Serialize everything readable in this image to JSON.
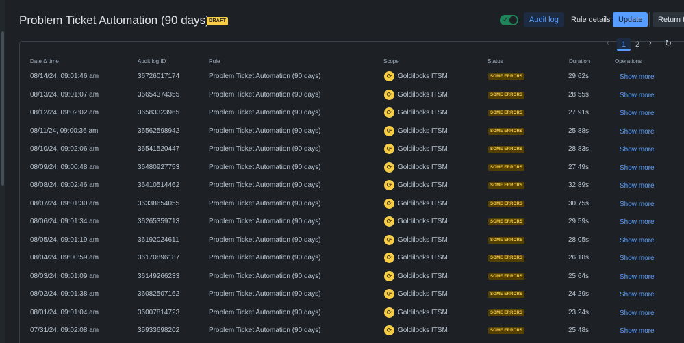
{
  "header": {
    "title": "Problem Ticket Automation (90 days)",
    "badge": "DRAFT",
    "toggle_check": "✓",
    "buttons": {
      "audit_log": "Audit log",
      "rule_details": "Rule details",
      "update": "Update",
      "return": "Return to list"
    }
  },
  "pagination": {
    "prev": "‹",
    "next": "›",
    "pages": [
      "1",
      "2"
    ],
    "current": "1",
    "refresh": "↻"
  },
  "table": {
    "columns": {
      "date": "Date & time",
      "audit_id": "Audit log ID",
      "rule": "Rule",
      "scope": "Scope",
      "status": "Status",
      "duration": "Duration",
      "operations": "Operations"
    },
    "rows": [
      {
        "date": "08/14/24, 09:01:46 am",
        "id": "36726017174",
        "rule": "Problem Ticket Automation (90 days)",
        "scope": "Goldilocks ITSM",
        "status": "SOME ERRORS",
        "duration": "29.62s",
        "op": "Show more"
      },
      {
        "date": "08/13/24, 09:01:07 am",
        "id": "36654374355",
        "rule": "Problem Ticket Automation (90 days)",
        "scope": "Goldilocks ITSM",
        "status": "SOME ERRORS",
        "duration": "28.55s",
        "op": "Show more"
      },
      {
        "date": "08/12/24, 09:02:02 am",
        "id": "36583323965",
        "rule": "Problem Ticket Automation (90 days)",
        "scope": "Goldilocks ITSM",
        "status": "SOME ERRORS",
        "duration": "27.91s",
        "op": "Show more"
      },
      {
        "date": "08/11/24, 09:00:36 am",
        "id": "36562598942",
        "rule": "Problem Ticket Automation (90 days)",
        "scope": "Goldilocks ITSM",
        "status": "SOME ERRORS",
        "duration": "25.88s",
        "op": "Show more"
      },
      {
        "date": "08/10/24, 09:02:06 am",
        "id": "36541520447",
        "rule": "Problem Ticket Automation (90 days)",
        "scope": "Goldilocks ITSM",
        "status": "SOME ERRORS",
        "duration": "28.83s",
        "op": "Show more"
      },
      {
        "date": "08/09/24, 09:00:48 am",
        "id": "36480927753",
        "rule": "Problem Ticket Automation (90 days)",
        "scope": "Goldilocks ITSM",
        "status": "SOME ERRORS",
        "duration": "27.49s",
        "op": "Show more"
      },
      {
        "date": "08/08/24, 09:02:46 am",
        "id": "36410514462",
        "rule": "Problem Ticket Automation (90 days)",
        "scope": "Goldilocks ITSM",
        "status": "SOME ERRORS",
        "duration": "32.89s",
        "op": "Show more"
      },
      {
        "date": "08/07/24, 09:01:30 am",
        "id": "36338654055",
        "rule": "Problem Ticket Automation (90 days)",
        "scope": "Goldilocks ITSM",
        "status": "SOME ERRORS",
        "duration": "30.75s",
        "op": "Show more"
      },
      {
        "date": "08/06/24, 09:01:34 am",
        "id": "36265359713",
        "rule": "Problem Ticket Automation (90 days)",
        "scope": "Goldilocks ITSM",
        "status": "SOME ERRORS",
        "duration": "29.59s",
        "op": "Show more"
      },
      {
        "date": "08/05/24, 09:01:19 am",
        "id": "36192024611",
        "rule": "Problem Ticket Automation (90 days)",
        "scope": "Goldilocks ITSM",
        "status": "SOME ERRORS",
        "duration": "28.05s",
        "op": "Show more"
      },
      {
        "date": "08/04/24, 09:00:59 am",
        "id": "36170896187",
        "rule": "Problem Ticket Automation (90 days)",
        "scope": "Goldilocks ITSM",
        "status": "SOME ERRORS",
        "duration": "26.18s",
        "op": "Show more"
      },
      {
        "date": "08/03/24, 09:01:09 am",
        "id": "36149266233",
        "rule": "Problem Ticket Automation (90 days)",
        "scope": "Goldilocks ITSM",
        "status": "SOME ERRORS",
        "duration": "25.64s",
        "op": "Show more"
      },
      {
        "date": "08/02/24, 09:01:38 am",
        "id": "36082507162",
        "rule": "Problem Ticket Automation (90 days)",
        "scope": "Goldilocks ITSM",
        "status": "SOME ERRORS",
        "duration": "24.29s",
        "op": "Show more"
      },
      {
        "date": "08/01/24, 09:01:04 am",
        "id": "36007814723",
        "rule": "Problem Ticket Automation (90 days)",
        "scope": "Goldilocks ITSM",
        "status": "SOME ERRORS",
        "duration": "23.24s",
        "op": "Show more"
      },
      {
        "date": "07/31/24, 09:02:08 am",
        "id": "35933698202",
        "rule": "Problem Ticket Automation (90 days)",
        "scope": "Goldilocks ITSM",
        "status": "SOME ERRORS",
        "duration": "25.48s",
        "op": "Show more"
      }
    ]
  },
  "colors": {
    "background": "#1d2125",
    "accent": "#579dff",
    "warning_text": "#f5cd47",
    "warning_bg": "#533f04",
    "toggle_on": "#1f845a"
  },
  "icons": {
    "scope": "goldilocks-project-icon",
    "refresh": "refresh-icon",
    "toggle": "check-icon"
  }
}
